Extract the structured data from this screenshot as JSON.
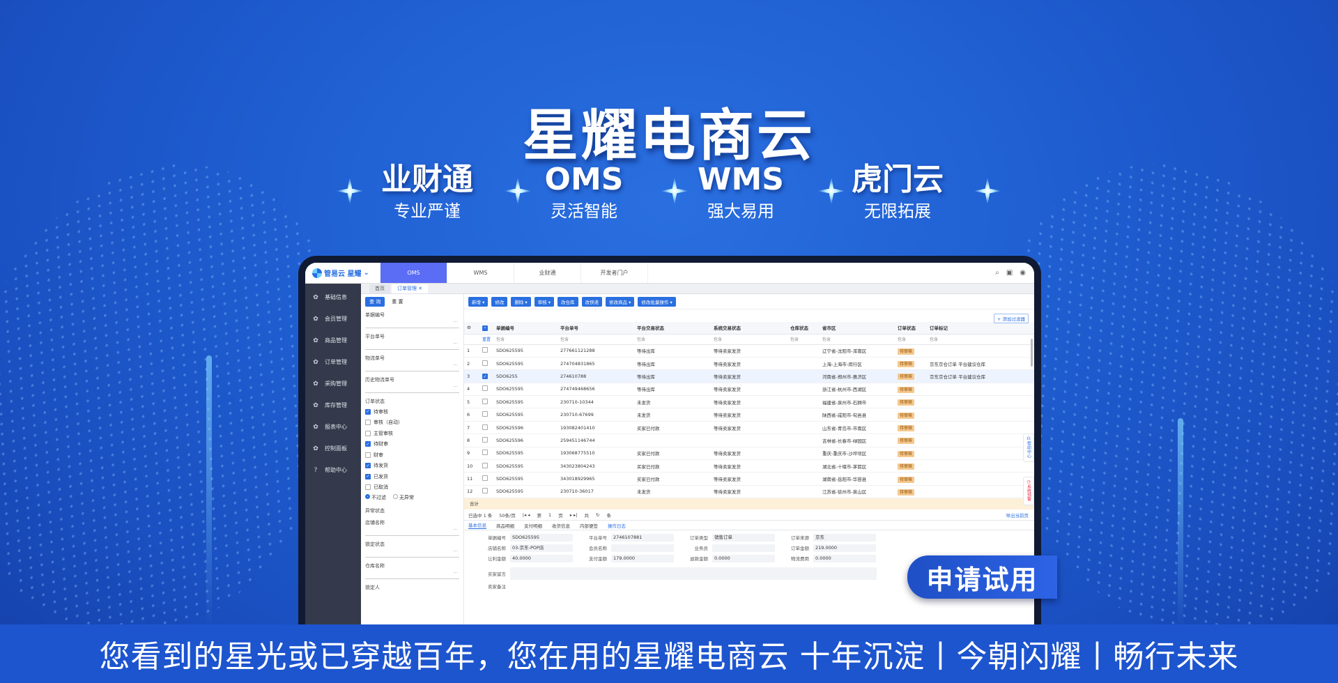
{
  "hero": {
    "title": "星耀电商云"
  },
  "features": [
    {
      "title": "业财通",
      "sub": "专业严谨"
    },
    {
      "title": "OMS",
      "sub": "灵活智能"
    },
    {
      "title": "WMS",
      "sub": "强大易用"
    },
    {
      "title": "虎门云",
      "sub": "无限拓展"
    }
  ],
  "app": {
    "logo": "管易云 星耀",
    "top_tabs": [
      "OMS",
      "WMS",
      "业财通",
      "开发者门户"
    ],
    "nav": [
      "基础信息",
      "会员管理",
      "商品管理",
      "订单管理",
      "采购管理",
      "库存管理",
      "报表中心",
      "控制面板",
      "帮助中心"
    ],
    "content_tabs": [
      "首页",
      "订单管理 ✕"
    ],
    "filters": {
      "query": "查 询",
      "reset": "重 置",
      "fields": [
        "单据编号",
        "平台单号",
        "物流单号",
        "历史物流单号"
      ],
      "order_status_label": "订单状态",
      "order_status": [
        {
          "label": "待审核",
          "checked": true
        },
        {
          "label": "审核（自动）",
          "checked": false
        },
        {
          "label": "主管审核",
          "checked": false
        },
        {
          "label": "待财审",
          "checked": true
        },
        {
          "label": "财审",
          "checked": false
        },
        {
          "label": "待发货",
          "checked": true
        },
        {
          "label": "已发货",
          "checked": true
        },
        {
          "label": "已取消",
          "checked": false
        }
      ],
      "radio_a": "不过滤",
      "radio_b": "无异常",
      "abnormal_label": "异常状态",
      "more_fields": [
        "店铺名称",
        "锁定状态",
        "仓库名称",
        "锁定人"
      ]
    },
    "toolbar": [
      "新增 ▾",
      "修改",
      "删除 ▾",
      "审核 ▾",
      "改仓库",
      "改快递",
      "修改商品 ▾",
      "修改批量操作 ▾"
    ],
    "add_filter": "+ 添加过滤器",
    "columns": [
      "",
      "",
      "单据编号",
      "平台单号",
      "平台交易状态",
      "系统交易状态",
      "仓库状态",
      "省市区",
      "订单状态",
      "订单标记"
    ],
    "filter_row": [
      "",
      "重置",
      "包含",
      "包含",
      "包含",
      "包含",
      "包含",
      "包含",
      "包含",
      "包含"
    ],
    "rows": [
      {
        "n": "1",
        "code": "SDO625595",
        "platform": "277661121288",
        "pstatus": "等待出库",
        "sstatus": "等待卖家发货",
        "region": "辽宁省-沈阳市-浑南区",
        "badge": "待审核",
        "mark": ""
      },
      {
        "n": "2",
        "code": "SDO625595",
        "platform": "274704831865",
        "pstatus": "等待出库",
        "sstatus": "等待卖家发货",
        "region": "上海-上海市-闵行区",
        "badge": "待审核",
        "mark": "京东京仓订单  平台建议仓库"
      },
      {
        "n": "3",
        "code": "SDO6255",
        "platform": "274610788",
        "pstatus": "等待出库",
        "sstatus": "等待卖家发货",
        "region": "河南省-郑州市-惠济区",
        "badge": "待审核",
        "mark": "京东京仓订单  平台建议仓库"
      },
      {
        "n": "4",
        "code": "SDO625595",
        "platform": "274749468656",
        "pstatus": "等待出库",
        "sstatus": "等待卖家发货",
        "region": "浙江省-杭州市-西湖区",
        "badge": "待审核",
        "mark": ""
      },
      {
        "n": "5",
        "code": "SDO625595",
        "platform": "230710-10344",
        "pstatus": "未发货",
        "sstatus": "等待卖家发货",
        "region": "福建省-泉州市-石狮市",
        "badge": "待审核",
        "mark": ""
      },
      {
        "n": "6",
        "code": "SDO625595",
        "platform": "230710-67699",
        "pstatus": "未发货",
        "sstatus": "等待卖家发货",
        "region": "陕西省-咸阳市-旬邑县",
        "badge": "待审核",
        "mark": ""
      },
      {
        "n": "7",
        "code": "SDO625596",
        "platform": "193082401410",
        "pstatus": "买家已付款",
        "sstatus": "等待卖家发货",
        "region": "山东省-青岛市-市南区",
        "badge": "待审核",
        "mark": ""
      },
      {
        "n": "8",
        "code": "SDO625596",
        "platform": "259451146744",
        "pstatus": "",
        "sstatus": "",
        "region": "吉林省-长春市-绿园区",
        "badge": "待审核",
        "mark": ""
      },
      {
        "n": "9",
        "code": "SDO625595",
        "platform": "193068775510",
        "pstatus": "买家已付款",
        "sstatus": "等待卖家发货",
        "region": "重庆-重庆市-沙坪坝区",
        "badge": "待审核",
        "mark": ""
      },
      {
        "n": "10",
        "code": "SDO625595",
        "platform": "343023804243",
        "pstatus": "买家已付款",
        "sstatus": "等待卖家发货",
        "region": "湖北省-十堰市-茅箭区",
        "badge": "待审核",
        "mark": ""
      },
      {
        "n": "11",
        "code": "SDO625595",
        "platform": "343018929965",
        "pstatus": "买家已付款",
        "sstatus": "等待卖家发货",
        "region": "湖南省-岳阳市-华容县",
        "badge": "待审核",
        "mark": ""
      },
      {
        "n": "12",
        "code": "SDO625595",
        "platform": "230710-36017",
        "pstatus": "未发货",
        "sstatus": "等待卖家发货",
        "region": "江苏省-徐州市-泉山区",
        "badge": "待审核",
        "mark": ""
      }
    ],
    "summary": "合计",
    "pager": {
      "selected": "已选中 1 条",
      "size": "50条/页",
      "page_label": "第",
      "page": "1",
      "of": "页",
      "total": "共",
      "unit": "条",
      "export": "导出当前页"
    },
    "detail_tabs": [
      "基本信息",
      "商品明细",
      "支付明细",
      "收货信息",
      "内部便签",
      "操作日志"
    ],
    "detail": [
      [
        "单据编号",
        "SDO625595",
        "平台单号",
        "2746107881",
        "订单类型",
        "销售订单",
        "订单来源",
        "京东"
      ],
      [
        "店铺名称",
        "03-京东-POP店",
        "会员名称",
        "",
        "业务员",
        "",
        "订单金额",
        "219.0000"
      ],
      [
        "让利金额",
        "40.0000",
        "支付金额",
        "179.0000",
        "退款金额",
        "0.0000",
        "物流费用",
        "0.0000"
      ]
    ],
    "remarks": [
      "买家留言",
      "卖家备注"
    ],
    "help_center": "帮助中心",
    "alert_center": "系统预警"
  },
  "cta": "申请试用",
  "slogan": "您看到的星光或已穿越百年，您在用的星耀电商云 十年沉淀丨今朝闪耀丨畅行未来"
}
